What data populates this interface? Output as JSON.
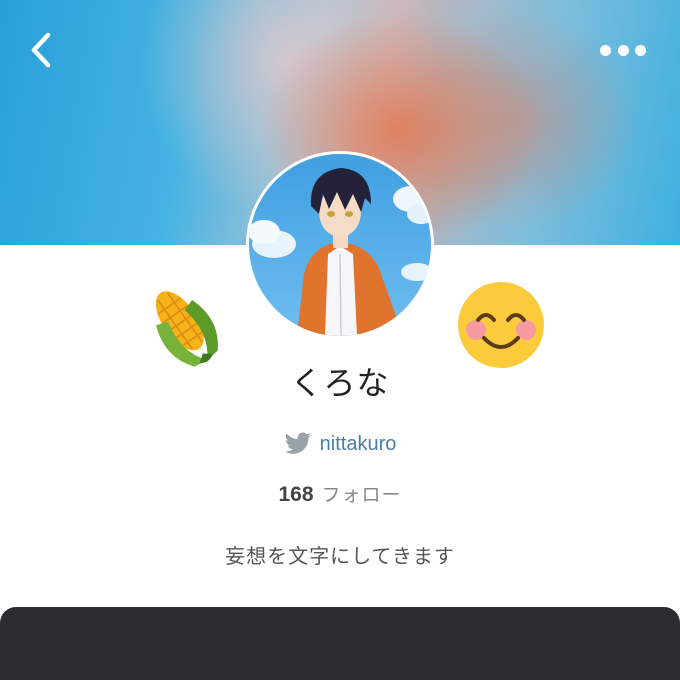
{
  "profile": {
    "display_name": "くろな",
    "twitter_handle": "nittakuro",
    "follow_count": "168",
    "follow_label": "フォロー",
    "bio": "妄想を文字にしてきます"
  },
  "header": {
    "back_icon": "chevron-left-icon",
    "menu_icon": "more-horizontal-icon"
  },
  "decorations": {
    "left_emoji": "corn",
    "right_emoji": "smiling-face-with-blush"
  },
  "colors": {
    "twitter": "#9aa1a8",
    "handle": "#4a7ea3",
    "bottom_bar": "#2b2e31"
  }
}
